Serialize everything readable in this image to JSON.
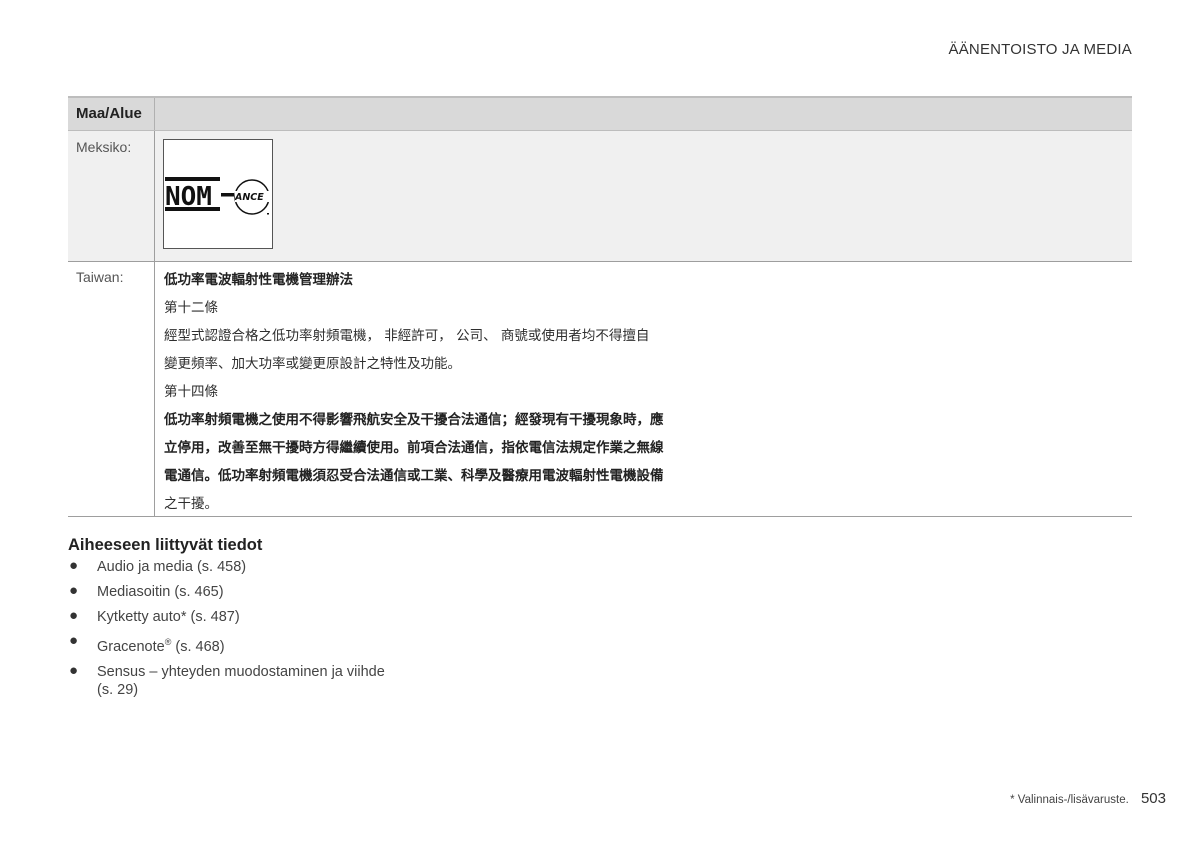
{
  "header": {
    "section_title": "ÄÄNENTOISTO JA MEDIA"
  },
  "table": {
    "column_header": "Maa/Alue",
    "rows": [
      {
        "country": "Meksiko:",
        "logo": {
          "name": "nom-ance-logo",
          "text_main": "NOM",
          "text_secondary": "ANCE"
        }
      },
      {
        "country": "Taiwan:",
        "lines": [
          "低功率電波輻射性電機管理辦法",
          "第十二條",
          "經型式認證合格之低功率射頻電機， 非經許可， 公司、 商號或使用者均不得擅自",
          "變更頻率、加大功率或變更原設計之特性及功能。",
          "第十四條",
          "低功率射頻電機之使用不得影響飛航安全及干擾合法通信；經發現有干擾現象時，應",
          "立停用，改善至無干擾時方得繼續使用。前項合法通信，指依電信法規定作業之無線",
          "電通信。低功率射頻電機須忍受合法通信或工業、科學及醫療用電波輻射性電機設備",
          "之干擾。"
        ]
      }
    ]
  },
  "related": {
    "title": "Aiheeseen liittyvät tiedot",
    "items": [
      {
        "text": "Audio ja media (s. 458)"
      },
      {
        "text": "Mediasoitin (s. 465)"
      },
      {
        "text": "Kytketty auto* (s. 487)"
      },
      {
        "text_before": "Gracenote",
        "sup": "®",
        "text_after": " (s. 468)"
      },
      {
        "line1": "Sensus – yhteyden muodostaminen ja viihde",
        "line2": "(s. 29)"
      }
    ]
  },
  "footer": {
    "note": "* Valinnais-/lisävaruste.",
    "page_number": "503"
  }
}
